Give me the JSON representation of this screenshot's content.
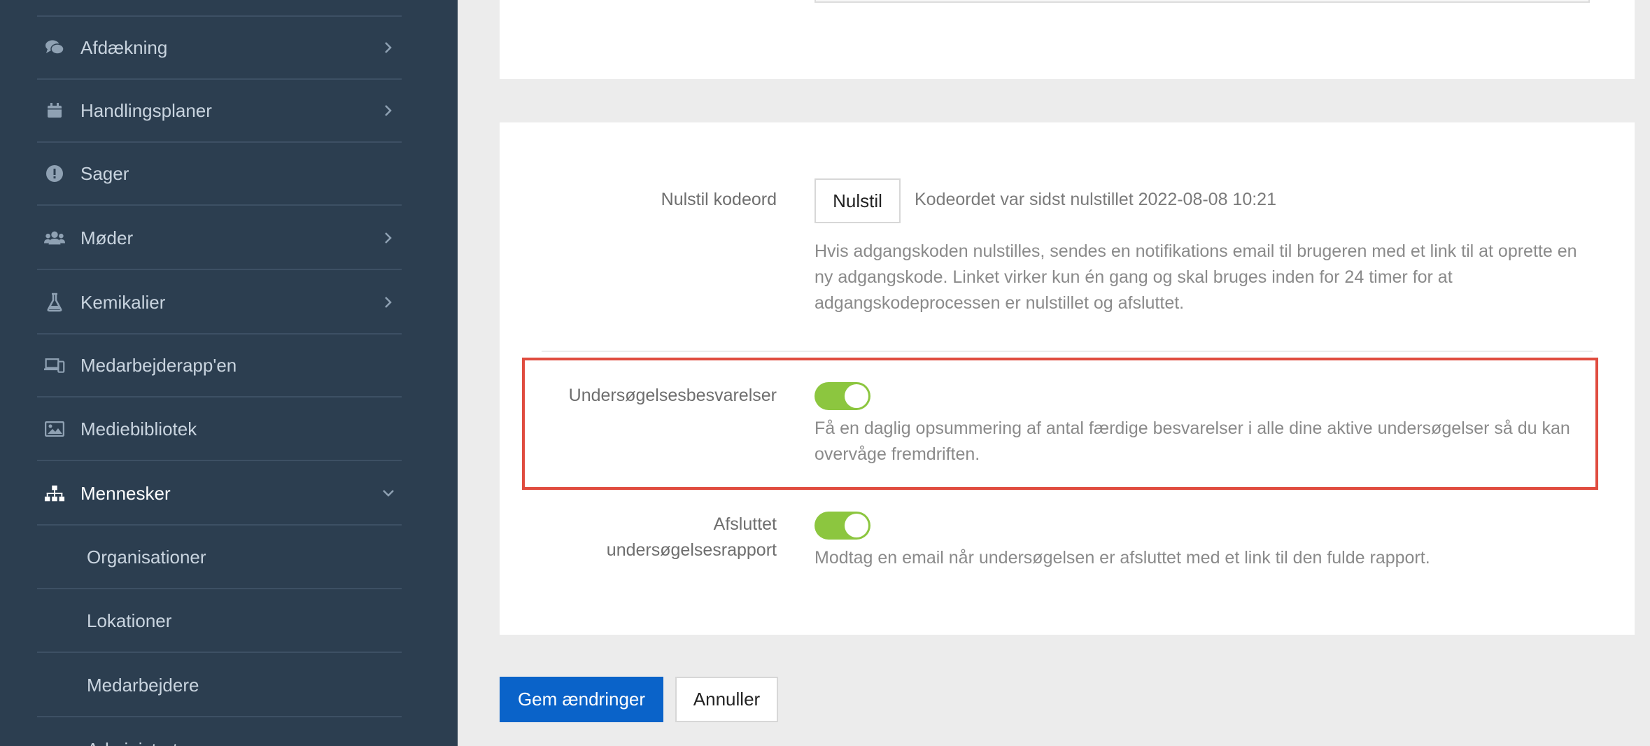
{
  "sidebar": {
    "items": [
      {
        "label": "Afdækning",
        "icon": "comments-icon",
        "chevron": "right"
      },
      {
        "label": "Handlingsplaner",
        "icon": "calendar-icon",
        "chevron": "right"
      },
      {
        "label": "Sager",
        "icon": "exclamation-circle-icon",
        "chevron": ""
      },
      {
        "label": "Møder",
        "icon": "users-icon",
        "chevron": "right"
      },
      {
        "label": "Kemikalier",
        "icon": "flask-icon",
        "chevron": "right"
      },
      {
        "label": "Medarbejderapp'en",
        "icon": "devices-icon",
        "chevron": ""
      },
      {
        "label": "Mediebibliotek",
        "icon": "image-icon",
        "chevron": ""
      },
      {
        "label": "Mennesker",
        "icon": "sitemap-icon",
        "chevron": "down",
        "active": true
      }
    ],
    "subitems": [
      {
        "label": "Organisationer"
      },
      {
        "label": "Lokationer"
      },
      {
        "label": "Medarbejdere"
      },
      {
        "label": "Administratorer"
      }
    ]
  },
  "password_reset": {
    "label": "Nulstil kodeord",
    "button_label": "Nulstil",
    "status": "Kodeordet var sidst nulstillet 2022-08-08 10:21",
    "help": "Hvis adgangskoden nulstilles, sendes en notifikations email til brugeren med et link til at oprette en ny adgangskode. Linket virker kun én gang og skal bruges inden for 24 timer for at adgangskodeprocessen er nulstillet og afsluttet."
  },
  "survey_responses": {
    "label": "Undersøgelsesbesvarelser",
    "enabled": true,
    "help": "Få en daglig opsummering af antal færdige besvarelser i alle dine aktive undersøgelser så du kan overvåge fremdriften."
  },
  "survey_report": {
    "label": "Afsluttet undersøgelsesrapport",
    "enabled": true,
    "help": "Modtag en email når undersøgelsen er afsluttet med et link til den fulde rapport."
  },
  "actions": {
    "save_label": "Gem ændringer",
    "cancel_label": "Annuller"
  },
  "colors": {
    "sidebar_bg": "#2c3e50",
    "primary": "#0a63c9",
    "toggle_on": "#8cc63f",
    "highlight": "#e04c3f"
  }
}
